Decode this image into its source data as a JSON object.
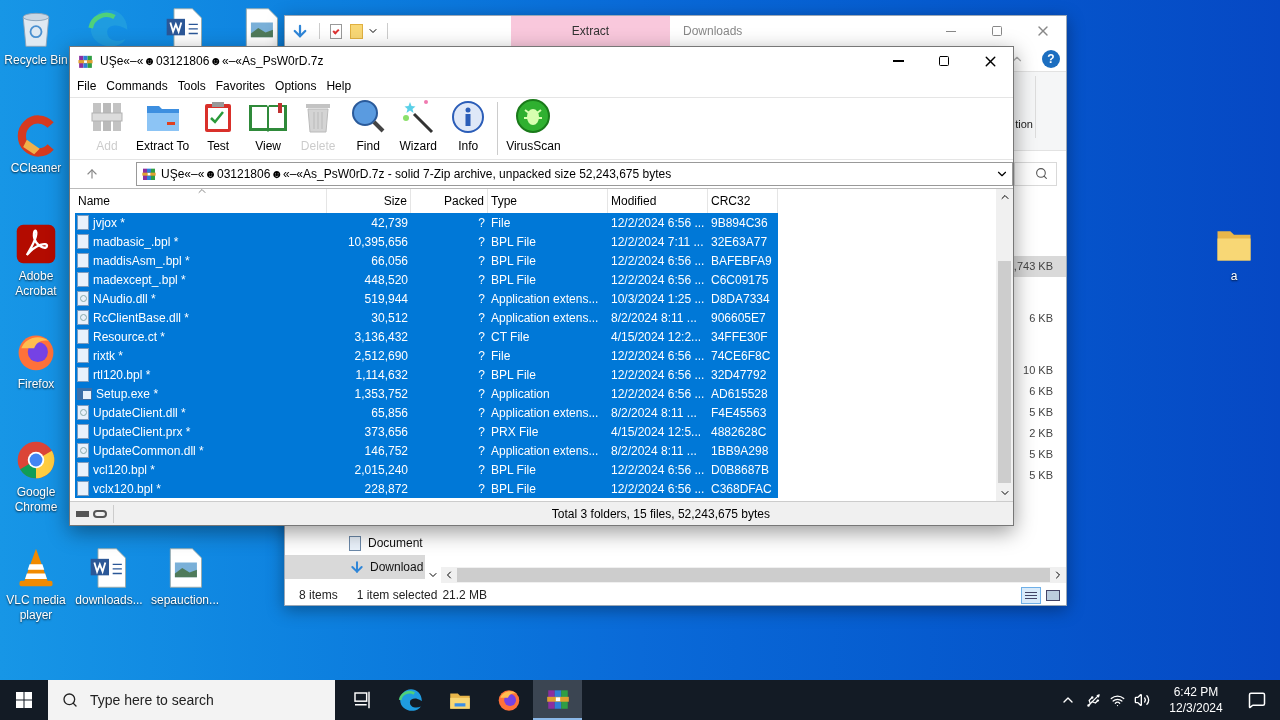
{
  "desktop": {
    "column": [
      {
        "label": "Recycle Bin",
        "kind": "recycle"
      },
      {
        "label": "CCleaner",
        "kind": "ccleaner"
      },
      {
        "label": "Adobe Acrobat",
        "kind": "acrobat"
      },
      {
        "label": "Firefox",
        "kind": "firefox"
      },
      {
        "label": "Google Chrome",
        "kind": "chrome"
      },
      {
        "label": "VLC media player",
        "kind": "vlc"
      }
    ],
    "top_row": [
      {
        "kind": "edge"
      },
      {
        "kind": "word"
      },
      {
        "kind": "image"
      }
    ],
    "bottom_row": [
      {
        "label": "downloads...",
        "kind": "word"
      },
      {
        "label": "sepauction...",
        "kind": "image"
      }
    ],
    "right": [
      {
        "label": "a",
        "kind": "folder"
      }
    ]
  },
  "explorer": {
    "help": "?",
    "ribbon_tab": "Extract",
    "title": "Downloads",
    "ribbon_label": "tion",
    "size_groups": [
      [
        {
          "text": ",743 KB",
          "selected": true
        }
      ],
      [
        {
          "text": "6 KB",
          "selected": false
        }
      ],
      [
        {
          "text": "10 KB",
          "selected": false
        },
        {
          "text": "6 KB",
          "selected": false
        },
        {
          "text": "5 KB",
          "selected": false
        },
        {
          "text": "2 KB",
          "selected": false
        },
        {
          "text": "5 KB",
          "selected": false
        },
        {
          "text": "5 KB",
          "selected": false
        }
      ]
    ],
    "nav": [
      {
        "label": "Document",
        "kind": "documents",
        "selected": false
      },
      {
        "label": "Download",
        "kind": "downloads",
        "selected": true
      }
    ],
    "status": {
      "count": "8 items",
      "selection": "1 item selected",
      "size": "21.2 MB"
    }
  },
  "winrar": {
    "title": "UŞe«–«☻03121806☻«–«As_PsW0rD.7z",
    "menu": [
      "File",
      "Commands",
      "Tools",
      "Favorites",
      "Options",
      "Help"
    ],
    "toolbar": [
      {
        "label": "Add",
        "kind": "add",
        "disabled": true
      },
      {
        "label": "Extract To",
        "kind": "extract",
        "disabled": false
      },
      {
        "label": "Test",
        "kind": "test",
        "disabled": false
      },
      {
        "label": "View",
        "kind": "view",
        "disabled": false
      },
      {
        "label": "Delete",
        "kind": "delete",
        "disabled": true
      },
      {
        "label": "Find",
        "kind": "find",
        "disabled": false
      },
      {
        "label": "Wizard",
        "kind": "wizard",
        "disabled": false
      },
      {
        "label": "Info",
        "kind": "info",
        "disabled": false
      },
      {
        "label": "VirusScan",
        "kind": "virus",
        "disabled": false
      }
    ],
    "address": "UŞe«–«☻03121806☻«–«As_PsW0rD.7z - solid 7-Zip archive, unpacked size 52,243,675 bytes",
    "columns": [
      "Name",
      "Size",
      "Packed",
      "Type",
      "Modified",
      "CRC32"
    ],
    "rows": [
      {
        "kind": "file",
        "selected": true,
        "cells": [
          "jvjox *",
          "42,739",
          "?",
          "File",
          "12/2/2024 6:56 ...",
          "9B894C36"
        ]
      },
      {
        "kind": "file",
        "selected": true,
        "cells": [
          "madbasic_.bpl *",
          "10,395,656",
          "?",
          "BPL File",
          "12/2/2024 7:11 ...",
          "32E63A77"
        ]
      },
      {
        "kind": "file",
        "selected": true,
        "cells": [
          "maddisAsm_.bpl *",
          "66,056",
          "?",
          "BPL File",
          "12/2/2024 6:56 ...",
          "BAFEBFA9"
        ]
      },
      {
        "kind": "file",
        "selected": true,
        "cells": [
          "madexcept_.bpl *",
          "448,520",
          "?",
          "BPL File",
          "12/2/2024 6:56 ...",
          "C6C09175"
        ]
      },
      {
        "kind": "dll",
        "selected": true,
        "cells": [
          "NAudio.dll *",
          "519,944",
          "?",
          "Application extens...",
          "10/3/2024 1:25 ...",
          "D8DA7334"
        ]
      },
      {
        "kind": "dll",
        "selected": true,
        "cells": [
          "RcClientBase.dll *",
          "30,512",
          "?",
          "Application extens...",
          "8/2/2024 8:11 ...",
          "906605E7"
        ]
      },
      {
        "kind": "file",
        "selected": true,
        "cells": [
          "Resource.ct *",
          "3,136,432",
          "?",
          "CT File",
          "4/15/2024 12:2...",
          "34FFE30F"
        ]
      },
      {
        "kind": "file",
        "selected": true,
        "cells": [
          "rixtk *",
          "2,512,690",
          "?",
          "File",
          "12/2/2024 6:56 ...",
          "74CE6F8C"
        ]
      },
      {
        "kind": "file",
        "selected": true,
        "cells": [
          "rtl120.bpl *",
          "1,114,632",
          "?",
          "BPL File",
          "12/2/2024 6:56 ...",
          "32D47792"
        ]
      },
      {
        "kind": "exe",
        "selected": true,
        "cells": [
          "Setup.exe *",
          "1,353,752",
          "?",
          "Application",
          "12/2/2024 6:56 ...",
          "AD615528"
        ]
      },
      {
        "kind": "dll",
        "selected": true,
        "cells": [
          "UpdateClient.dll *",
          "65,856",
          "?",
          "Application extens...",
          "8/2/2024 8:11 ...",
          "F4E45563"
        ]
      },
      {
        "kind": "file",
        "selected": true,
        "cells": [
          "UpdateClient.prx *",
          "373,656",
          "?",
          "PRX File",
          "4/15/2024 12:5...",
          "4882628C"
        ]
      },
      {
        "kind": "dll",
        "selected": true,
        "cells": [
          "UpdateCommon.dll *",
          "146,752",
          "?",
          "Application extens...",
          "8/2/2024 8:11 ...",
          "1BB9A298"
        ]
      },
      {
        "kind": "file",
        "selected": true,
        "cells": [
          "vcl120.bpl *",
          "2,015,240",
          "?",
          "BPL File",
          "12/2/2024 6:56 ...",
          "D0B8687B"
        ]
      },
      {
        "kind": "file",
        "selected": true,
        "cells": [
          "vclx120.bpl *",
          "228,872",
          "?",
          "BPL File",
          "12/2/2024 6:56 ...",
          "C368DFAC"
        ]
      }
    ],
    "status": "Total 3 folders, 15 files, 52,243,675 bytes"
  },
  "taskbar": {
    "search_placeholder": "Type here to search",
    "apps": [
      {
        "kind": "taskview",
        "selected": false
      },
      {
        "kind": "edge",
        "selected": false
      },
      {
        "kind": "explorer",
        "selected": false
      },
      {
        "kind": "firefox",
        "selected": false
      },
      {
        "kind": "winrar",
        "selected": true
      }
    ],
    "time": "6:42 PM",
    "date": "12/3/2024"
  }
}
